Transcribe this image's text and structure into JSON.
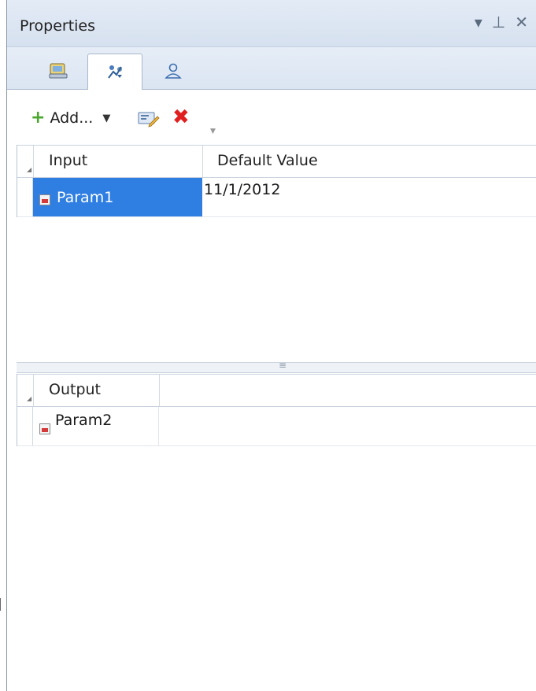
{
  "panel": {
    "title": "Properties",
    "controls": {
      "menu": "▾",
      "pin": "⊥",
      "close": "✕"
    }
  },
  "tabs": [
    {
      "icon": "general-properties-icon",
      "active": false
    },
    {
      "icon": "parameters-icon",
      "active": true
    },
    {
      "icon": "user-icon",
      "active": false
    }
  ],
  "toolbar": {
    "add_label": "Add...",
    "add_dropdown": "▼",
    "edit_icon": "edit-icon",
    "delete_icon": "delete-icon"
  },
  "input_grid": {
    "columns": [
      "Input",
      "Default Value"
    ],
    "rows": [
      {
        "name": "Param1",
        "value": "11/1/2012",
        "selected": true
      }
    ]
  },
  "output_grid": {
    "columns": [
      "Output"
    ],
    "rows": [
      {
        "name": "Param2"
      }
    ]
  },
  "colors": {
    "selection": "#2f7fe2",
    "add_green": "#4aa62d",
    "delete_red": "#e02020"
  }
}
